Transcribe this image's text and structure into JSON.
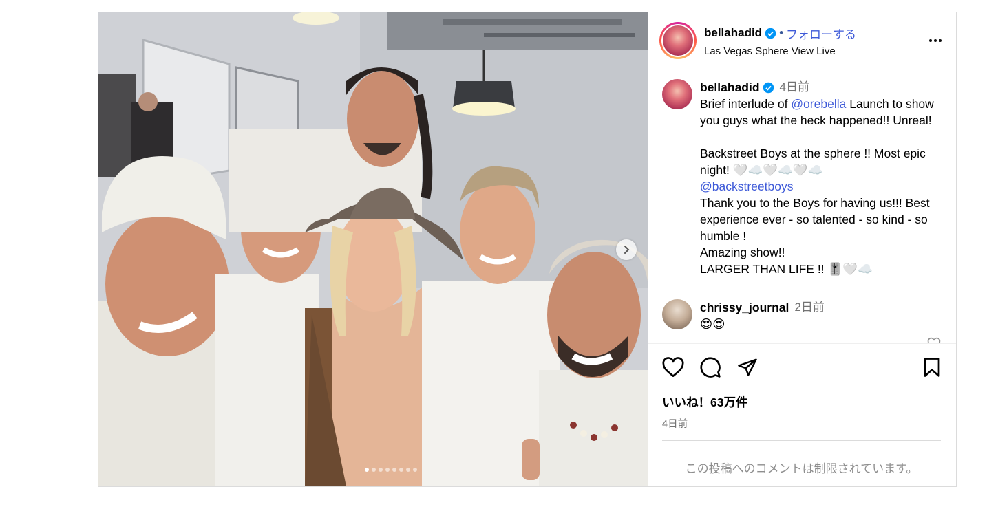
{
  "header": {
    "username": "bellahadid",
    "separator": "•",
    "follow_label": "フォローする",
    "location": "Las Vegas Sphere View Live"
  },
  "caption": {
    "username": "bellahadid",
    "time": "4日前",
    "text_1": "Brief interlude of ",
    "mention_1": "@orebella",
    "text_2": " Launch to show you guys what the heck happened!! Unreal!\n\nBackstreet Boys at the sphere !! Most epic night! 🤍☁️🤍☁️🤍☁️\n",
    "mention_2": "@backstreetboys",
    "text_3": "\nThank you to the Boys for having us!!! Best experience ever - so talented - so kind - so humble !\nAmazing show!!\nLARGER THAN LIFE !! 🎚️🤍☁️"
  },
  "comment": {
    "username": "chrissy_journal",
    "time": "2日前",
    "text": "😍😍"
  },
  "actions": {
    "likes": "いいね！63万件",
    "date": "4日前",
    "restricted": "この投稿へのコメントは制限されています。"
  },
  "carousel": {
    "total": 8,
    "active_index": 0
  },
  "colors": {
    "link": "#3e5ad8",
    "verified": "#0095f6",
    "muted": "#737373"
  }
}
